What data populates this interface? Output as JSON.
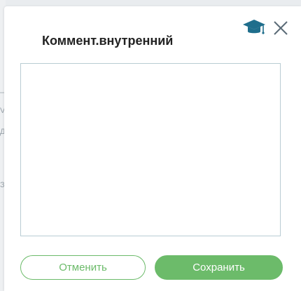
{
  "dialog": {
    "title": "Коммент.внутренний",
    "textarea": {
      "value": "",
      "placeholder": ""
    },
    "buttons": {
      "cancel_label": "Отменить",
      "save_label": "Сохранить"
    },
    "icons": {
      "help": "graduation-cap-icon",
      "close": "close-icon"
    },
    "colors": {
      "accent": "#6cbb6a",
      "help_icon": "#1f6e8c",
      "close_icon": "#5b6b77",
      "textarea_border": "#b9ccd3"
    }
  },
  "background": {
    "glyphs": [
      "–",
      "V",
      "Д",
      "З"
    ]
  }
}
